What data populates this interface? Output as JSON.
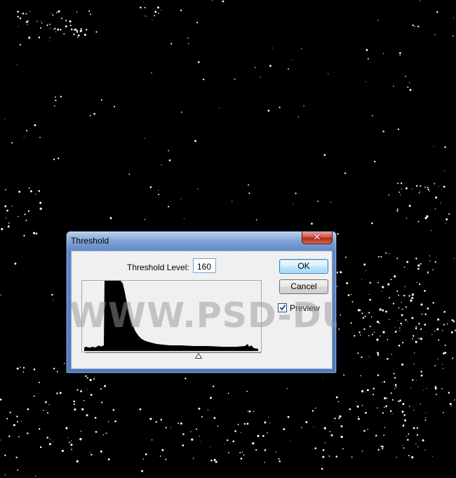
{
  "dialog": {
    "title": "Threshold",
    "close_symbol": "✕",
    "threshold_level_label": "Threshold Level:",
    "threshold_level_value": "160",
    "ok_label": "OK",
    "cancel_label": "Cancel",
    "preview_label": "Preview",
    "preview_checked": true
  },
  "watermark": "WWW.PSD-DUDE.COM",
  "colors": {
    "canvas_background": "#000000",
    "speckle": "#ffffff",
    "titlebar_blue": "#5f87c2",
    "close_red": "#c74134",
    "histogram_fill": "#000000"
  },
  "histogram": {
    "levels": [
      0,
      255
    ],
    "threshold_marker": 160
  }
}
